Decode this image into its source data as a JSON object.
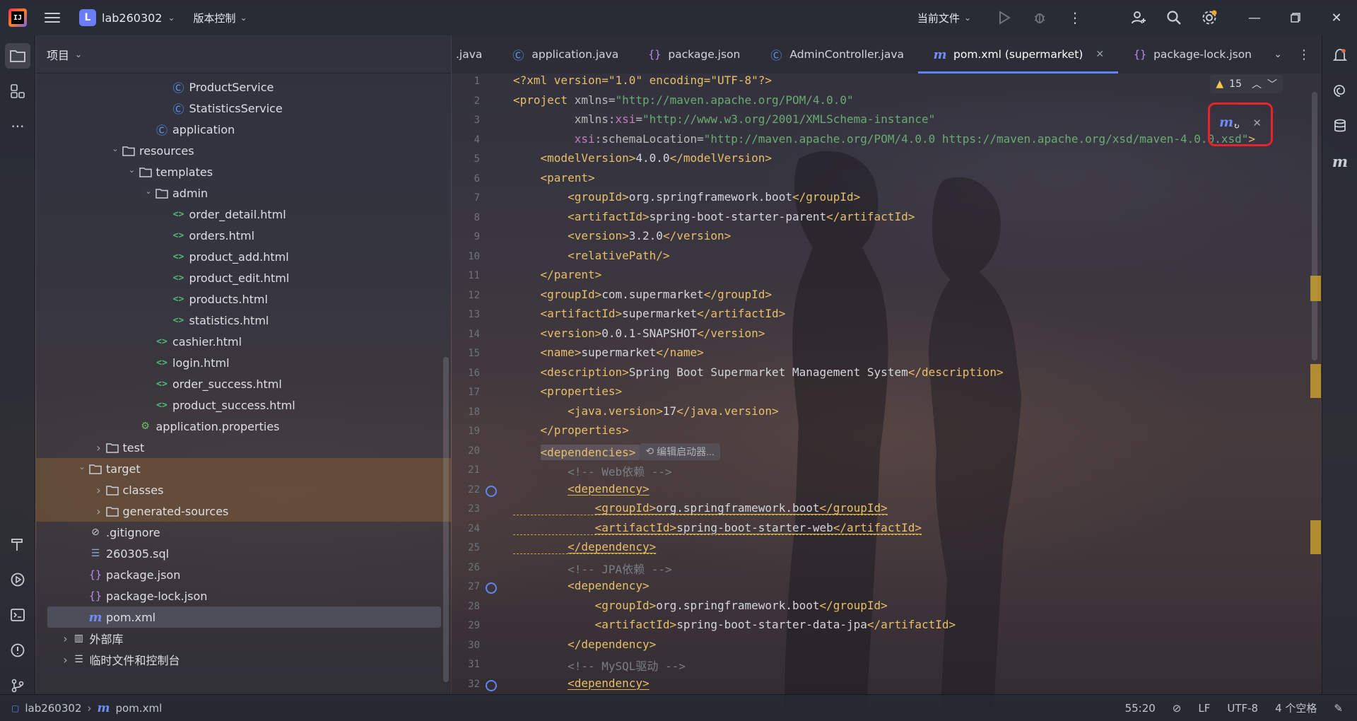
{
  "titlebar": {
    "project_initial": "L",
    "project_name": "lab260302",
    "vcs_label": "版本控制",
    "current_file_label": "当前文件"
  },
  "project_panel": {
    "title": "项目",
    "tree": [
      {
        "label": "ProductService",
        "icon": "class-icon",
        "depth": 7
      },
      {
        "label": "StatisticsService",
        "icon": "class-icon",
        "depth": 7
      },
      {
        "label": "application",
        "icon": "spring-class-icon",
        "depth": 6
      },
      {
        "label": "resources",
        "icon": "resources-folder-icon",
        "depth": 4,
        "arrow": "expanded"
      },
      {
        "label": "templates",
        "icon": "folder-icon",
        "depth": 5,
        "arrow": "expanded"
      },
      {
        "label": "admin",
        "icon": "folder-icon",
        "depth": 6,
        "arrow": "expanded"
      },
      {
        "label": "order_detail.html",
        "icon": "html-icon",
        "depth": 7
      },
      {
        "label": "orders.html",
        "icon": "html-icon",
        "depth": 7
      },
      {
        "label": "product_add.html",
        "icon": "html-icon",
        "depth": 7
      },
      {
        "label": "product_edit.html",
        "icon": "html-icon",
        "depth": 7
      },
      {
        "label": "products.html",
        "icon": "html-icon",
        "depth": 7
      },
      {
        "label": "statistics.html",
        "icon": "html-icon",
        "depth": 7
      },
      {
        "label": "cashier.html",
        "icon": "html-icon",
        "depth": 6
      },
      {
        "label": "login.html",
        "icon": "html-icon",
        "depth": 6
      },
      {
        "label": "order_success.html",
        "icon": "html-icon",
        "depth": 6
      },
      {
        "label": "product_success.html",
        "icon": "html-icon",
        "depth": 6
      },
      {
        "label": "application.properties",
        "icon": "properties-icon",
        "depth": 5
      },
      {
        "label": "test",
        "icon": "folder-icon",
        "depth": 3,
        "arrow": "collapsed"
      },
      {
        "label": "target",
        "icon": "folder-icon",
        "depth": 2,
        "arrow": "expanded",
        "highlight": true
      },
      {
        "label": "classes",
        "icon": "folder-icon",
        "depth": 3,
        "arrow": "collapsed",
        "highlight": true
      },
      {
        "label": "generated-sources",
        "icon": "folder-icon",
        "depth": 3,
        "arrow": "collapsed",
        "highlight": true
      },
      {
        "label": ".gitignore",
        "icon": "gitignore-icon",
        "depth": 2
      },
      {
        "label": "260305.sql",
        "icon": "sql-icon",
        "depth": 2
      },
      {
        "label": "package.json",
        "icon": "json-icon",
        "depth": 2
      },
      {
        "label": "package-lock.json",
        "icon": "json-icon",
        "depth": 2
      },
      {
        "label": "pom.xml",
        "icon": "maven-icon",
        "depth": 2,
        "selected": true
      },
      {
        "label": "外部库",
        "icon": "library-icon",
        "depth": 1,
        "arrow": "collapsed"
      },
      {
        "label": "临时文件和控制台",
        "icon": "scratch-icon",
        "depth": 1,
        "arrow": "collapsed"
      }
    ]
  },
  "editor": {
    "tabs": [
      {
        "label": ".java",
        "icon": "",
        "active": false
      },
      {
        "label": "application.java",
        "icon": "spring-class-icon",
        "active": false
      },
      {
        "label": "package.json",
        "icon": "json-icon",
        "active": false
      },
      {
        "label": "AdminController.java",
        "icon": "class-icon",
        "active": false
      },
      {
        "label": "pom.xml (supermarket)",
        "icon": "maven-icon",
        "active": true,
        "closable": true
      },
      {
        "label": "package-lock.json",
        "icon": "json-icon",
        "active": false
      }
    ],
    "warning_count": "15",
    "inline_hint": "编辑启动器...",
    "first_line_number": 1,
    "lines": [
      [
        [
          "pi",
          "<?xml version=\"1.0\" encoding=\"UTF-8\"?>"
        ]
      ],
      [
        [
          "tag",
          "<project "
        ],
        [
          "attr",
          "xmlns="
        ],
        [
          "str",
          "\"http://maven.apache.org/POM/4.0.0\""
        ]
      ],
      [
        [
          "text",
          "         "
        ],
        [
          "attr",
          "xmlns:"
        ],
        [
          "ns",
          "xsi"
        ],
        [
          "attr",
          "="
        ],
        [
          "str",
          "\"http://www.w3.org/2001/XMLSchema-instance\""
        ]
      ],
      [
        [
          "text",
          "         "
        ],
        [
          "ns",
          "xsi"
        ],
        [
          "attr",
          ":schemaLocation="
        ],
        [
          "str",
          "\"http://maven.apache.org/POM/4.0.0 https://maven.apache.org/xsd/maven-4.0.0.xsd\""
        ],
        [
          "tag",
          ">"
        ]
      ],
      [
        [
          "text",
          "    "
        ],
        [
          "tag",
          "<modelVersion>"
        ],
        [
          "text",
          "4.0.0"
        ],
        [
          "tag",
          "</modelVersion>"
        ]
      ],
      [
        [
          "text",
          "    "
        ],
        [
          "tag",
          "<parent>"
        ]
      ],
      [
        [
          "text",
          "        "
        ],
        [
          "tag",
          "<groupId>"
        ],
        [
          "text",
          "org.springframework.boot"
        ],
        [
          "tag",
          "</groupId>"
        ]
      ],
      [
        [
          "text",
          "        "
        ],
        [
          "tag",
          "<artifactId>"
        ],
        [
          "text",
          "spring-boot-starter-parent"
        ],
        [
          "tag",
          "</artifactId>"
        ]
      ],
      [
        [
          "text",
          "        "
        ],
        [
          "tag",
          "<version>"
        ],
        [
          "text",
          "3.2.0"
        ],
        [
          "tag",
          "</version>"
        ]
      ],
      [
        [
          "text",
          "        "
        ],
        [
          "tag",
          "<relativePath/>"
        ]
      ],
      [
        [
          "text",
          "    "
        ],
        [
          "tag",
          "</parent>"
        ]
      ],
      [
        [
          "text",
          "    "
        ],
        [
          "tag",
          "<groupId>"
        ],
        [
          "text",
          "com.supermarket"
        ],
        [
          "tag",
          "</groupId>"
        ]
      ],
      [
        [
          "text",
          "    "
        ],
        [
          "tag",
          "<artifactId>"
        ],
        [
          "text",
          "supermarket"
        ],
        [
          "tag",
          "</artifactId>"
        ]
      ],
      [
        [
          "text",
          "    "
        ],
        [
          "tag",
          "<version>"
        ],
        [
          "text",
          "0.0.1-SNAPSHOT"
        ],
        [
          "tag",
          "</version>"
        ]
      ],
      [
        [
          "text",
          "    "
        ],
        [
          "tag",
          "<name>"
        ],
        [
          "text",
          "supermarket"
        ],
        [
          "tag",
          "</name>"
        ]
      ],
      [
        [
          "text",
          "    "
        ],
        [
          "tag",
          "<description>"
        ],
        [
          "text",
          "Spring Boot Supermarket Management System"
        ],
        [
          "tag",
          "</description>"
        ]
      ],
      [
        [
          "text",
          "    "
        ],
        [
          "tag",
          "<properties>"
        ]
      ],
      [
        [
          "text",
          "        "
        ],
        [
          "tag",
          "<java.version>"
        ],
        [
          "text",
          "17"
        ],
        [
          "tag",
          "</java.version>"
        ]
      ],
      [
        [
          "text",
          "    "
        ],
        [
          "tag",
          "</properties>"
        ]
      ],
      [
        [
          "text",
          "    "
        ],
        [
          "tag",
          "<dependencies>"
        ],
        [
          "hint",
          ""
        ]
      ],
      [
        [
          "text",
          "        "
        ],
        [
          "comment",
          "<!-- Web依赖 -->"
        ]
      ],
      [
        [
          "text",
          "        "
        ],
        [
          "tagu",
          "<dependency>"
        ]
      ],
      [
        [
          "text",
          "            "
        ],
        [
          "tagu",
          "<groupId>"
        ],
        [
          "textu",
          "org.springframework.boot"
        ],
        [
          "tagu",
          "</groupId>"
        ]
      ],
      [
        [
          "text",
          "            "
        ],
        [
          "tagu",
          "<artifactId>"
        ],
        [
          "textu",
          "spring-boot-starter-web"
        ],
        [
          "tagu",
          "</artifactId>"
        ]
      ],
      [
        [
          "text",
          "        "
        ],
        [
          "tagu",
          "</dependency>"
        ]
      ],
      [
        [
          "text",
          "        "
        ],
        [
          "comment",
          "<!-- JPA依赖 -->"
        ]
      ],
      [
        [
          "text",
          "        "
        ],
        [
          "tag",
          "<dependency>"
        ]
      ],
      [
        [
          "text",
          "            "
        ],
        [
          "tag",
          "<groupId>"
        ],
        [
          "text",
          "org.springframework.boot"
        ],
        [
          "tag",
          "</groupId>"
        ]
      ],
      [
        [
          "text",
          "            "
        ],
        [
          "tag",
          "<artifactId>"
        ],
        [
          "text",
          "spring-boot-starter-data-jpa"
        ],
        [
          "tag",
          "</artifactId>"
        ]
      ],
      [
        [
          "text",
          "        "
        ],
        [
          "tag",
          "</dependency>"
        ]
      ],
      [
        [
          "text",
          "        "
        ],
        [
          "comment",
          "<!-- MySQL驱动 -->"
        ]
      ],
      [
        [
          "text",
          "        "
        ],
        [
          "tagu",
          "<dependency>"
        ]
      ]
    ],
    "gutter_marks": [
      22,
      27,
      32
    ]
  },
  "statusbar": {
    "project": "lab260302",
    "file": "pom.xml",
    "position": "55:20",
    "line_separator": "LF",
    "encoding": "UTF-8",
    "indent": "4 个空格"
  },
  "colors": {
    "accent": "#5d86f5",
    "highlight_box": "#e8242a",
    "warning": "#f2c94c"
  }
}
